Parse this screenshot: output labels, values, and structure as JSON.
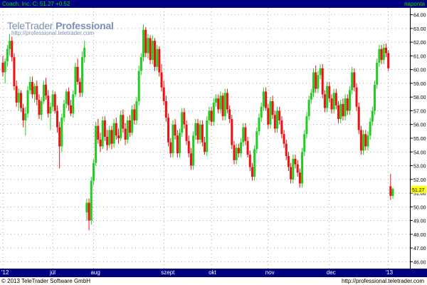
{
  "header": {
    "title": "Coach, Inc. C: 51.27 +0.52",
    "interval": "napontа"
  },
  "logo": {
    "brand_light": "TeleTrader",
    "brand_bold": "Professional",
    "url": "http://professional.teletrader.com"
  },
  "footer": {
    "copyright": "© 2013 TeleTrader Software GmbH",
    "url": "http://professional.teletrader.com"
  },
  "colors": {
    "up": "#22cc22",
    "down": "#ee1111",
    "bar_bg": "#000080",
    "last_label_bg": "#ffff00",
    "logo": "#7a8fb8"
  },
  "chart_data": {
    "type": "candlestick",
    "ylim": [
      45.5,
      64.5
    ],
    "y_ticks": [
      "46.00",
      "47.00",
      "48.00",
      "49.00",
      "50.00",
      "51.00",
      "52.00",
      "53.00",
      "54.00",
      "55.00",
      "56.00",
      "57.00",
      "58.00",
      "59.00",
      "60.00",
      "61.00",
      "62.00",
      "63.00",
      "64.00"
    ],
    "last_value": "51.27",
    "x_labels": [
      {
        "label": "'12",
        "index": 0
      },
      {
        "label": "júl",
        "index": 22
      },
      {
        "label": "aug",
        "index": 40
      },
      {
        "label": "szept",
        "index": 71
      },
      {
        "label": "okt",
        "index": 92
      },
      {
        "label": "nov",
        "index": 117
      },
      {
        "label": "dec",
        "index": 144
      },
      {
        "label": "'13",
        "index": 170
      }
    ],
    "ohlc": [
      [
        60.5,
        61.0,
        59.5,
        59.8
      ],
      [
        59.8,
        60.8,
        59.0,
        60.6
      ],
      [
        60.6,
        61.8,
        60.2,
        61.5
      ],
      [
        61.5,
        62.6,
        61.0,
        62.1
      ],
      [
        62.1,
        62.4,
        60.6,
        60.9
      ],
      [
        60.9,
        61.2,
        58.5,
        58.8
      ],
      [
        58.8,
        59.2,
        57.3,
        57.6
      ],
      [
        57.6,
        58.6,
        57.0,
        58.3
      ],
      [
        58.3,
        58.5,
        56.9,
        57.2
      ],
      [
        57.2,
        57.5,
        55.8,
        56.3
      ],
      [
        56.3,
        57.3,
        55.2,
        56.8
      ],
      [
        56.8,
        58.8,
        56.5,
        58.5
      ],
      [
        58.5,
        59.5,
        58.2,
        59.1
      ],
      [
        59.1,
        59.5,
        57.9,
        58.2
      ],
      [
        58.2,
        59.0,
        57.6,
        58.8
      ],
      [
        58.8,
        59.2,
        57.4,
        57.8
      ],
      [
        57.8,
        58.2,
        56.4,
        56.7
      ],
      [
        56.7,
        58.0,
        56.3,
        57.7
      ],
      [
        57.7,
        59.2,
        57.5,
        58.9
      ],
      [
        58.9,
        59.4,
        57.8,
        58.1
      ],
      [
        58.1,
        58.5,
        56.5,
        56.8
      ],
      [
        56.8,
        57.6,
        55.6,
        57.3
      ],
      [
        57.3,
        58.5,
        57.0,
        58.2
      ],
      [
        58.2,
        58.4,
        56.8,
        57.0
      ],
      [
        57.0,
        57.4,
        55.4,
        55.8
      ],
      [
        55.8,
        56.2,
        52.8,
        54.4
      ],
      [
        54.4,
        56.8,
        54.0,
        56.5
      ],
      [
        56.5,
        57.8,
        56.2,
        57.5
      ],
      [
        57.5,
        58.6,
        57.2,
        58.4
      ],
      [
        58.4,
        58.7,
        57.0,
        57.4
      ],
      [
        57.4,
        57.8,
        56.6,
        56.8
      ],
      [
        56.8,
        58.5,
        56.5,
        58.2
      ],
      [
        58.2,
        60.5,
        58.0,
        60.2
      ],
      [
        60.2,
        60.8,
        58.9,
        59.1
      ],
      [
        59.1,
        59.4,
        58.0,
        58.3
      ],
      [
        58.3,
        61.3,
        58.0,
        60.9
      ],
      [
        60.9,
        62.1,
        60.5,
        61.6
      ],
      [
        49.6,
        50.6,
        49.0,
        50.3
      ],
      [
        50.3,
        50.6,
        48.3,
        49.0
      ],
      [
        49.0,
        52.2,
        48.7,
        51.9
      ],
      [
        51.9,
        53.5,
        51.6,
        53.2
      ],
      [
        53.2,
        56.2,
        53.0,
        55.9
      ],
      [
        55.9,
        56.4,
        54.6,
        54.9
      ],
      [
        54.9,
        55.4,
        54.0,
        54.4
      ],
      [
        54.4,
        56.6,
        54.2,
        56.3
      ],
      [
        56.3,
        56.6,
        54.8,
        55.1
      ],
      [
        55.1,
        55.6,
        54.1,
        54.5
      ],
      [
        54.5,
        55.9,
        54.3,
        55.6
      ],
      [
        55.6,
        55.9,
        54.2,
        54.6
      ],
      [
        54.6,
        56.4,
        54.3,
        56.1
      ],
      [
        56.1,
        56.5,
        54.9,
        55.2
      ],
      [
        55.2,
        55.7,
        54.6,
        55.0
      ],
      [
        55.0,
        57.0,
        54.8,
        56.7
      ],
      [
        56.7,
        57.1,
        55.4,
        55.7
      ],
      [
        55.7,
        56.1,
        54.5,
        54.9
      ],
      [
        54.9,
        56.6,
        54.6,
        56.3
      ],
      [
        56.3,
        56.7,
        55.1,
        55.4
      ],
      [
        55.4,
        57.4,
        55.2,
        57.1
      ],
      [
        57.1,
        57.5,
        56.0,
        56.3
      ],
      [
        56.3,
        58.0,
        56.0,
        57.7
      ],
      [
        57.7,
        60.3,
        57.4,
        59.9
      ],
      [
        59.9,
        61.2,
        59.6,
        60.9
      ],
      [
        60.9,
        63.3,
        60.6,
        62.9
      ],
      [
        62.9,
        63.1,
        60.9,
        61.2
      ],
      [
        61.2,
        62.6,
        60.8,
        62.3
      ],
      [
        62.3,
        62.5,
        60.4,
        60.7
      ],
      [
        60.7,
        62.5,
        60.4,
        62.1
      ],
      [
        62.1,
        62.3,
        59.9,
        60.2
      ],
      [
        60.2,
        61.8,
        59.9,
        61.5
      ],
      [
        61.5,
        61.7,
        59.5,
        59.8
      ],
      [
        59.8,
        60.4,
        58.4,
        58.7
      ],
      [
        58.7,
        59.2,
        57.4,
        57.7
      ],
      [
        57.7,
        58.1,
        56.2,
        56.5
      ],
      [
        56.5,
        56.8,
        54.4,
        54.7
      ],
      [
        54.7,
        55.0,
        53.6,
        53.9
      ],
      [
        53.9,
        56.3,
        53.6,
        56.0
      ],
      [
        56.0,
        56.4,
        54.9,
        55.2
      ],
      [
        55.2,
        55.6,
        53.6,
        53.9
      ],
      [
        53.9,
        55.7,
        53.6,
        55.4
      ],
      [
        55.4,
        57.2,
        55.1,
        56.9
      ],
      [
        56.9,
        57.2,
        55.7,
        56.0
      ],
      [
        56.0,
        56.3,
        54.5,
        54.8
      ],
      [
        54.8,
        55.2,
        53.6,
        53.9
      ],
      [
        53.9,
        54.3,
        52.7,
        53.0
      ],
      [
        53.0,
        55.5,
        52.7,
        55.2
      ],
      [
        55.2,
        56.4,
        54.9,
        56.1
      ],
      [
        56.1,
        56.4,
        54.6,
        54.9
      ],
      [
        54.9,
        56.3,
        54.6,
        56.0
      ],
      [
        56.0,
        56.3,
        54.4,
        54.7
      ],
      [
        54.7,
        55.1,
        53.8,
        54.0
      ],
      [
        54.0,
        56.6,
        53.7,
        56.3
      ],
      [
        56.3,
        57.3,
        56.0,
        57.0
      ],
      [
        57.0,
        57.3,
        55.9,
        56.2
      ],
      [
        56.2,
        57.9,
        55.9,
        57.6
      ],
      [
        57.6,
        58.2,
        57.3,
        57.9
      ],
      [
        57.9,
        58.2,
        56.8,
        57.1
      ],
      [
        57.1,
        58.4,
        56.8,
        58.1
      ],
      [
        58.1,
        58.3,
        56.3,
        56.6
      ],
      [
        56.6,
        58.6,
        56.3,
        58.3
      ],
      [
        58.3,
        58.6,
        56.8,
        57.1
      ],
      [
        57.1,
        57.4,
        56.1,
        56.4
      ],
      [
        56.4,
        56.7,
        54.2,
        54.5
      ],
      [
        54.5,
        54.8,
        53.1,
        53.4
      ],
      [
        53.4,
        54.6,
        53.1,
        54.3
      ],
      [
        54.3,
        54.6,
        53.6,
        53.9
      ],
      [
        53.9,
        55.0,
        53.6,
        54.7
      ],
      [
        54.7,
        56.1,
        54.4,
        55.8
      ],
      [
        55.8,
        56.1,
        54.5,
        54.8
      ],
      [
        54.8,
        55.1,
        53.6,
        53.8
      ],
      [
        53.8,
        54.1,
        52.6,
        52.9
      ],
      [
        52.9,
        53.2,
        51.9,
        52.2
      ],
      [
        52.2,
        54.5,
        51.9,
        54.2
      ],
      [
        54.2,
        55.8,
        53.9,
        55.5
      ],
      [
        55.5,
        56.8,
        55.2,
        56.5
      ],
      [
        56.5,
        57.6,
        56.2,
        57.3
      ],
      [
        57.3,
        58.7,
        57.0,
        58.4
      ],
      [
        58.4,
        58.7,
        57.0,
        57.2
      ],
      [
        57.2,
        57.5,
        55.7,
        56.0
      ],
      [
        56.0,
        58.0,
        55.7,
        57.7
      ],
      [
        57.7,
        58.1,
        56.4,
        56.7
      ],
      [
        56.7,
        57.0,
        55.4,
        55.7
      ],
      [
        55.7,
        57.3,
        55.4,
        57.0
      ],
      [
        57.0,
        57.3,
        56.0,
        56.3
      ],
      [
        56.3,
        56.6,
        55.0,
        55.3
      ],
      [
        55.3,
        55.6,
        54.3,
        54.6
      ],
      [
        54.6,
        54.9,
        53.4,
        53.7
      ],
      [
        53.7,
        54.0,
        52.6,
        52.9
      ],
      [
        52.9,
        53.2,
        51.7,
        52.0
      ],
      [
        52.0,
        53.8,
        51.7,
        53.5
      ],
      [
        53.5,
        53.8,
        52.8,
        53.1
      ],
      [
        53.1,
        53.4,
        52.2,
        52.5
      ],
      [
        52.5,
        52.8,
        51.4,
        51.7
      ],
      [
        51.7,
        54.3,
        51.4,
        54.0
      ],
      [
        54.0,
        55.6,
        53.7,
        55.3
      ],
      [
        55.3,
        56.9,
        55.0,
        56.6
      ],
      [
        56.6,
        58.1,
        56.3,
        57.8
      ],
      [
        57.8,
        58.6,
        57.5,
        58.3
      ],
      [
        58.3,
        60.1,
        58.0,
        59.8
      ],
      [
        59.8,
        60.3,
        58.3,
        58.6
      ],
      [
        58.6,
        59.9,
        58.3,
        59.6
      ],
      [
        59.6,
        60.4,
        59.3,
        60.1
      ],
      [
        60.1,
        60.4,
        57.9,
        58.2
      ],
      [
        58.2,
        58.5,
        56.9,
        57.2
      ],
      [
        57.2,
        59.1,
        56.9,
        58.8
      ],
      [
        58.8,
        59.1,
        57.6,
        57.9
      ],
      [
        57.9,
        58.2,
        56.8,
        57.1
      ],
      [
        57.1,
        58.6,
        56.8,
        58.3
      ],
      [
        58.3,
        58.6,
        57.1,
        57.4
      ],
      [
        57.4,
        57.7,
        56.1,
        56.4
      ],
      [
        56.4,
        57.8,
        56.1,
        57.5
      ],
      [
        57.5,
        57.9,
        56.3,
        56.6
      ],
      [
        56.6,
        58.2,
        56.3,
        57.9
      ],
      [
        57.9,
        58.2,
        56.7,
        57.0
      ],
      [
        57.0,
        58.8,
        56.7,
        58.5
      ],
      [
        58.5,
        60.2,
        58.2,
        59.8
      ],
      [
        59.8,
        60.1,
        58.4,
        58.7
      ],
      [
        58.7,
        59.0,
        57.0,
        57.3
      ],
      [
        57.3,
        57.6,
        55.3,
        55.6
      ],
      [
        55.6,
        55.9,
        53.8,
        54.1
      ],
      [
        54.1,
        55.6,
        53.8,
        55.3
      ],
      [
        55.3,
        55.6,
        54.1,
        54.4
      ],
      [
        54.4,
        55.5,
        54.1,
        55.2
      ],
      [
        55.2,
        56.5,
        54.9,
        56.2
      ],
      [
        56.2,
        57.3,
        55.9,
        57.0
      ],
      [
        57.0,
        59.2,
        56.7,
        58.9
      ],
      [
        58.9,
        60.8,
        58.6,
        60.5
      ],
      [
        60.5,
        61.8,
        60.2,
        61.5
      ],
      [
        61.5,
        61.8,
        60.4,
        60.7
      ],
      [
        60.7,
        61.9,
        60.4,
        61.6
      ],
      [
        61.6,
        61.9,
        60.9,
        61.2
      ],
      [
        61.2,
        61.4,
        59.9,
        60.1
      ],
      [
        51.5,
        52.4,
        50.5,
        50.8
      ],
      [
        50.8,
        51.4,
        50.6,
        51.3
      ]
    ]
  }
}
